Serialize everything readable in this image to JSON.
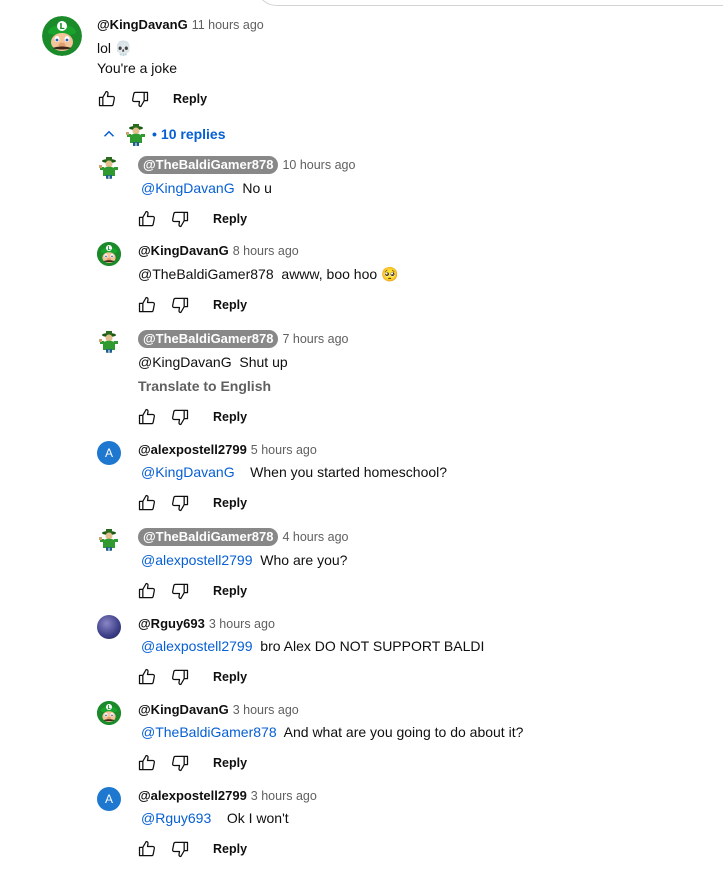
{
  "colors": {
    "link": "#065fd4",
    "text": "#0f0f0f",
    "secondary": "#606060",
    "chip": "#888888"
  },
  "main_comment": {
    "author": "@KingDavanG",
    "time": "11 hours ago",
    "line1": "lol 💀",
    "line2": "You're a joke",
    "avatar_icon": "luigi-avatar-icon",
    "reply_label": "Reply"
  },
  "replies_toggle": {
    "label": "10 replies"
  },
  "replies": [
    {
      "author": "@TheBaldiGamer878",
      "time": "10 hours ago",
      "mention": "@KingDavanG",
      "text": "No u",
      "reply_label": "Reply"
    },
    {
      "author": "@KingDavanG",
      "time": "8 hours ago",
      "mention": "@TheBaldiGamer878",
      "text": "awww, boo hoo 🥺",
      "reply_label": "Reply"
    },
    {
      "author": "@TheBaldiGamer878",
      "time": "7 hours ago",
      "mention": "@KingDavanG",
      "text": "Shut up",
      "translate": "Translate to English",
      "reply_label": "Reply"
    },
    {
      "author": "@alexpostell2799",
      "time": "5 hours ago",
      "mention": "@KingDavanG",
      "text": "When you started homeschool?",
      "avatar_letter": "A",
      "reply_label": "Reply"
    },
    {
      "author": "@TheBaldiGamer878",
      "time": "4 hours ago",
      "mention": "@alexpostell2799",
      "text": "Who are you?",
      "reply_label": "Reply"
    },
    {
      "author": "@Rguy693",
      "time": "3 hours ago",
      "mention": "@alexpostell2799",
      "text": "bro Alex DO NOT SUPPORT BALDI",
      "reply_label": "Reply"
    },
    {
      "author": "@KingDavanG",
      "time": "3 hours ago",
      "mention": "@TheBaldiGamer878",
      "text": "And what are you going to do about it?",
      "reply_label": "Reply"
    },
    {
      "author": "@alexpostell2799",
      "time": "3 hours ago",
      "mention": "@Rguy693",
      "text": "Ok I won't",
      "avatar_letter": "A",
      "reply_label": "Reply"
    }
  ]
}
